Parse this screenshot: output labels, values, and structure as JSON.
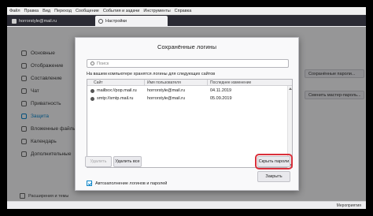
{
  "menubar": [
    "Файл",
    "Правка",
    "Вид",
    "Переход",
    "Сообщение",
    "События и задачи",
    "Инструменты",
    "Справка"
  ],
  "tabs": {
    "mail": "horrorstyle@mail.ru",
    "settings": "Настройки"
  },
  "sidebar": {
    "items": [
      {
        "label": "Основные",
        "icon": "gear-icon"
      },
      {
        "label": "Отображение",
        "icon": "brush-icon"
      },
      {
        "label": "Составление",
        "icon": "pencil-icon"
      },
      {
        "label": "Чат",
        "icon": "chat-icon"
      },
      {
        "label": "Приватность",
        "icon": "mask-icon"
      },
      {
        "label": "Защита",
        "icon": "lock-icon",
        "active": true
      },
      {
        "label": "Вложенные файлы",
        "icon": "paperclip-icon"
      },
      {
        "label": "Календарь",
        "icon": "calendar-icon"
      },
      {
        "label": "Дополнительные",
        "icon": "wrench-icon"
      }
    ],
    "footer": "Расширения и темы"
  },
  "background_buttons": {
    "saved_passwords": "Сохранённые пароли...",
    "master_password": "Сменить мастер-пароль..."
  },
  "statusbar": {
    "events": "Мероприятия"
  },
  "dialog": {
    "title": "Сохранённые логины",
    "search_placeholder": "Поиск",
    "info": "На вашем компьютере хранятся логины для следующих сайтов",
    "columns": [
      "Сайт",
      "Имя пользователя",
      "Последнее изменение"
    ],
    "rows": [
      {
        "site": "mailbox://pop.mail.ru",
        "user": "horrorstyle@mail.ru",
        "changed": "04.11.2019"
      },
      {
        "site": "smtp://smtp.mail.ru",
        "user": "horrorstyle@mail.ru",
        "changed": "05.09.2019"
      }
    ],
    "autofill_label": "Автозаполнение логинов и паролей",
    "buttons": {
      "delete": "Удалить",
      "delete_all": "Удалить все",
      "hide_passwords": "Скрыть пароли",
      "close": "Закрыть"
    },
    "highlight_color": "#d9303b"
  }
}
